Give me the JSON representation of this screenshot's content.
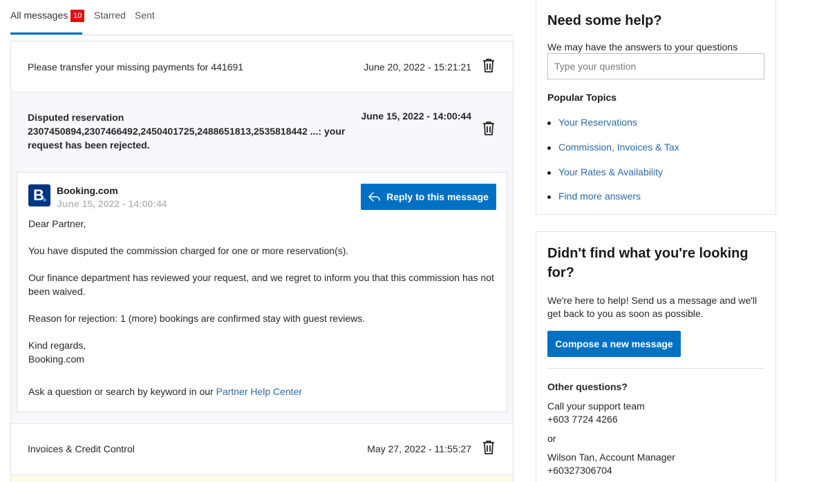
{
  "tabs": {
    "all_messages": "All messages",
    "unread_count": "10",
    "starred": "Starred",
    "sent": "Sent"
  },
  "messages": [
    {
      "subject": "Please transfer your missing payments for 441691",
      "date": "June 20, 2022 - 15:21:21"
    },
    {
      "subject": "Disputed reservation 2307450894,2307466492,2450401725,2488651813,2535818442 ...: your request has been rejected.",
      "date": "June 15, 2022 - 14:00:44"
    },
    {
      "subject": "Invoices & Credit Control",
      "date": "May 27, 2022 - 11:55:27"
    }
  ],
  "expanded": {
    "logo_letter": "B",
    "sender": "Booking.com",
    "date": "June 15, 2022 - 14:00:44",
    "reply_label": "Reply to this message",
    "greeting": "Dear Partner,",
    "p1": "You have disputed the commission charged for one or more reservation(s).",
    "p2": "Our finance department has reviewed your request, and we regret to inform you that this commission has not been waived.",
    "p3": "Reason for rejection: 1 (more) bookings are confirmed stay with guest reviews.",
    "signoff1": "Kind regards,",
    "signoff2": "Booking.com",
    "footer_text": "Ask a question or search by keyword in our ",
    "footer_link": "Partner Help Center"
  },
  "help": {
    "title": "Need some help?",
    "subtitle": "We may have the answers to your questions",
    "search_placeholder": "Type your question",
    "topics_title": "Popular Topics",
    "topics": [
      "Your Reservations",
      "Commission, Invoices & Tax",
      "Your Rates & Availability",
      "Find more answers"
    ]
  },
  "contact": {
    "title": "Didn't find what you're looking for?",
    "text": "We're here to help! Send us a message and we'll get back to you as soon as possible.",
    "compose_label": "Compose a new message",
    "other_title": "Other questions?",
    "support_label": "Call your support team",
    "support_phone": "+603 7724 4266",
    "or": "or",
    "manager": "Wilson Tan, Account Manager",
    "manager_phone": "+60327306704"
  },
  "colors": {
    "accent": "#0071c2",
    "link": "#2c6aa6",
    "badge": "#e21111",
    "brand": "#003580"
  }
}
